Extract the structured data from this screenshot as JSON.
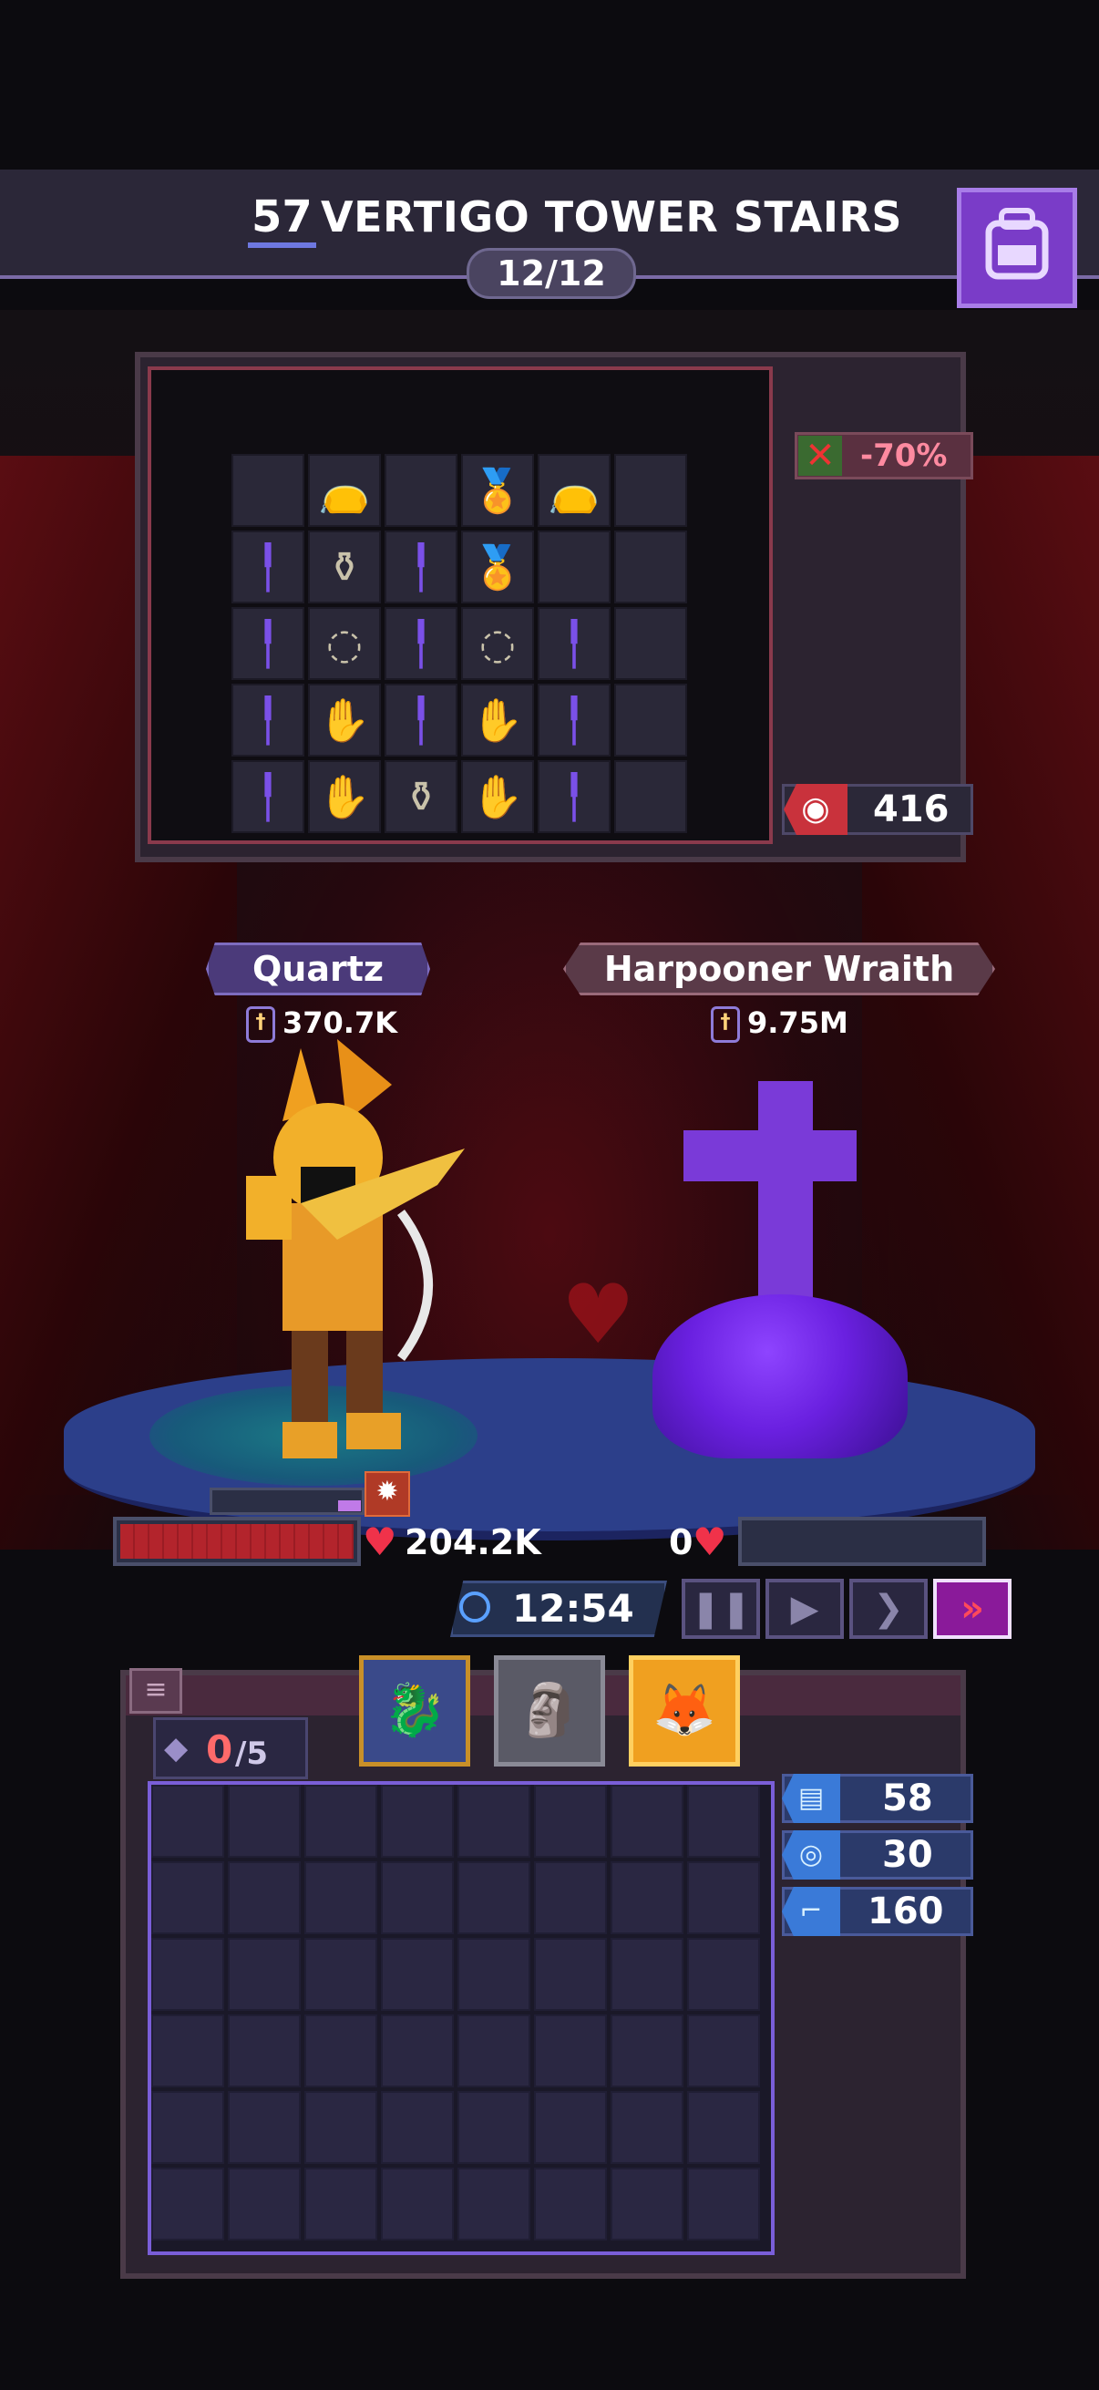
{
  "header": {
    "floor_number": "57",
    "floor_title": "VERTIGO TOWER STAIRS",
    "wave": "12/12",
    "backpack_icon": "backpack-icon"
  },
  "enemy_backpack": {
    "debuff": "-70%",
    "armor": "416",
    "grid_items": [
      "",
      "pouch",
      "",
      "medal",
      "pouch",
      "",
      "spear",
      "potion",
      "spear",
      "medal",
      "",
      "",
      "spear",
      "bracelet",
      "spear",
      "bracelet",
      "spear",
      "",
      "spear",
      "gauntlet",
      "spear",
      "gauntlet",
      "spear",
      "",
      "spear",
      "gauntlet",
      "potion",
      "gauntlet",
      "spear",
      ""
    ]
  },
  "player": {
    "name": "Quartz",
    "power": "370.7K",
    "hp": "204.2K",
    "energy_fraction": 0.15
  },
  "enemy": {
    "name": "Harpooner Wraith",
    "power": "9.75M",
    "hp": "0"
  },
  "controls": {
    "timer": "12:54",
    "speed_selected": "fastest"
  },
  "backpack": {
    "gems": "0",
    "gems_max": "/5",
    "portraits": [
      "dragon-knight",
      "stone-golem",
      "fox-cat"
    ],
    "stats": [
      {
        "icon": "book-icon",
        "value": "58"
      },
      {
        "icon": "shield-icon",
        "value": "30"
      },
      {
        "icon": "boot-icon",
        "value": "160"
      }
    ]
  },
  "colors": {
    "accent": "#7a3cc8",
    "hp_red": "#b3242c",
    "speed_active": "#8a1a9a"
  }
}
